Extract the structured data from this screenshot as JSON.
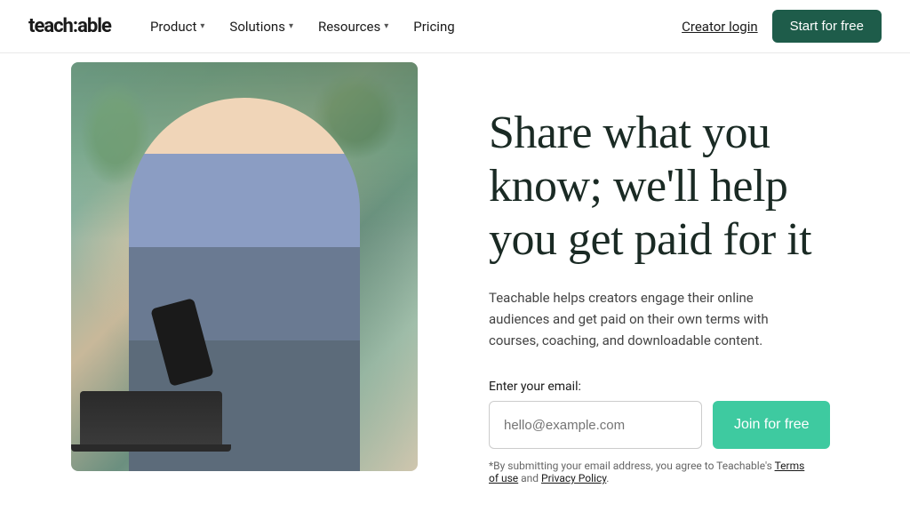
{
  "navbar": {
    "logo": "teach:able",
    "nav_items": [
      {
        "label": "Product",
        "has_dropdown": true
      },
      {
        "label": "Solutions",
        "has_dropdown": true
      },
      {
        "label": "Resources",
        "has_dropdown": true
      },
      {
        "label": "Pricing",
        "has_dropdown": false
      }
    ],
    "creator_login_label": "Creator login",
    "start_btn_label": "Start for free"
  },
  "hero": {
    "title": "Share what you know; we'll help you get paid for it",
    "subtitle": "Teachable helps creators engage their online audiences and get paid on their own terms with courses, coaching, and downloadable content.",
    "email_label": "Enter your email:",
    "email_placeholder": "hello@example.com",
    "join_btn_label": "Join for free",
    "fine_print": "*By submitting your email address, you agree to Teachable's ",
    "terms_label": "Terms of use",
    "and_label": " and ",
    "privacy_label": "Privacy Policy",
    "fine_print_end": "."
  },
  "colors": {
    "logo": "#1a1a1a",
    "nav_text": "#1a1a1a",
    "start_btn_bg": "#1e5c4a",
    "join_btn_bg": "#3ecaa0",
    "hero_title": "#1a2a24"
  }
}
